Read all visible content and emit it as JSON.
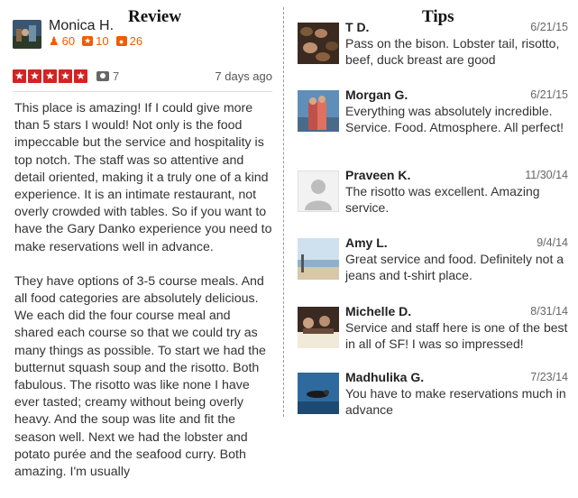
{
  "headings": {
    "review": "Review",
    "tips": "Tips"
  },
  "reviewer": {
    "name": "Monica H.",
    "friends": "60",
    "reviews": "10",
    "photos": "26"
  },
  "review": {
    "rating": 5,
    "photo_count": "7",
    "date": "7 days ago",
    "paragraphs": [
      "This place is amazing! If I could give more than 5 stars I would! Not only is the food impeccable but the service and hospitality is top notch. The staff was so attentive and detail oriented, making it a truly one of a kind experience. It is an intimate restaurant, not overly crowded with tables. So if you want to have the Gary Danko experience you need to make reservations well in advance.",
      "They have options of 3-5 course meals. And all food categories are absolutely delicious. We each did the four course meal and shared each course so that we could try as many things as possible. To start we had the butternut squash soup and the risotto. Both fabulous. The risotto was like none I have ever tasted; creamy without being overly heavy. And the soup was lite and fit the season well. Next we had the lobster and potato purée and the seafood curry. Both amazing. I'm usually"
    ]
  },
  "tips": [
    {
      "name": "T D.",
      "date": "6/21/15",
      "text": "Pass on the bison. Lobster tail, risotto, beef, duck breast are good",
      "thumb": "food"
    },
    {
      "name": "Morgan G.",
      "date": "6/21/15",
      "text": "Everything was absolutely incredible. Service. Food. Atmosphere.  All perfect!",
      "thumb": "couple"
    },
    {
      "name": "Praveen K.",
      "date": "11/30/14",
      "text": "The risotto was excellent. Amazing service.",
      "thumb": "default"
    },
    {
      "name": "Amy L.",
      "date": "9/4/14",
      "text": "Great service and food. Definitely not a jeans and t-shirt place.",
      "thumb": "beach"
    },
    {
      "name": "Michelle D.",
      "date": "8/31/14",
      "text": "Service and staff here is one of the best in all of SF! I was so impressed!",
      "thumb": "dinner"
    },
    {
      "name": "Madhulika G.",
      "date": "7/23/14",
      "text": "You have to make reservations much in advance",
      "thumb": "diver"
    }
  ]
}
